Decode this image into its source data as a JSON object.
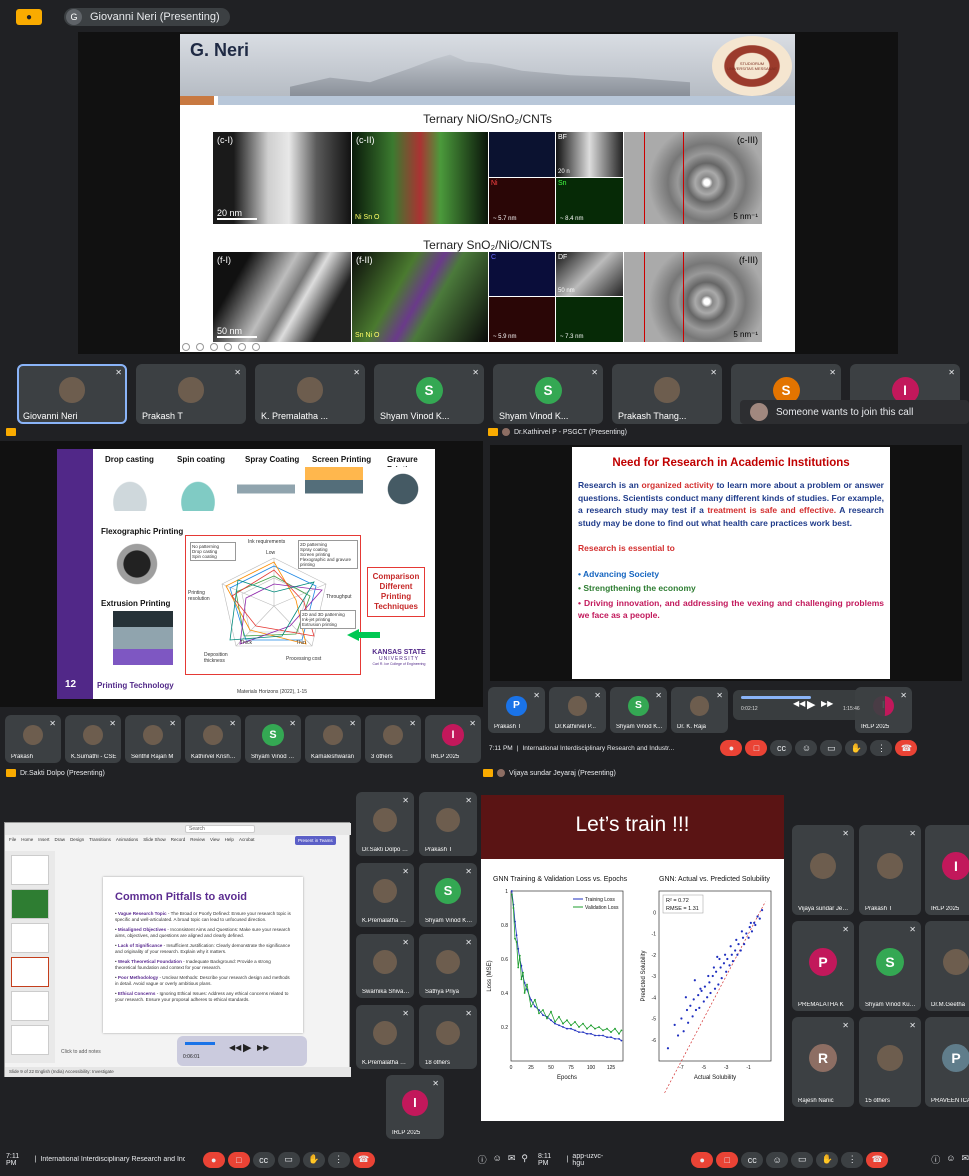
{
  "p1": {
    "presenter_name": "Giovanni Neri (Presenting)",
    "avatar_letter": "G",
    "slide": {
      "title": "G. Neri",
      "seal_text": "STUDIORUM UNIVERSITAS MESSANAE",
      "caption1": "Ternary NiO/SnO₂/CNTs",
      "caption2": "Ternary SnO₂/NiO/CNTs",
      "panels_top": [
        "(c-I)",
        "(c-II)",
        "BF",
        "(c-III)"
      ],
      "panels_bottom": [
        "(f-I)",
        "(f-II)",
        "C",
        "DF",
        "(f-III)"
      ],
      "scale_top": "20 nm",
      "scale_bottom": "50 nm",
      "scale_5nm": "5 nm⁻¹",
      "edx_top": "Ni Sn O",
      "edx_bottom": "Sn Ni O",
      "ni_label": "Ni",
      "sn_label": "Sn",
      "bf_scale": "20 n",
      "df_scale": "50 nm",
      "meas": [
        "~ 5.7 nm",
        "~ 8.4 nm",
        "~ 5.9 nm",
        "~ 7.3 nm"
      ]
    },
    "participants": [
      {
        "name": "Giovanni Neri",
        "letter": "",
        "color": "#5f6368",
        "selected": true
      },
      {
        "name": "Prakash T",
        "letter": "",
        "color": "",
        "selected": false
      },
      {
        "name": "K. Premalatha ...",
        "letter": "",
        "color": "",
        "selected": false
      },
      {
        "name": "Shyam Vinod K...",
        "letter": "S",
        "color": "#34a853",
        "selected": false
      },
      {
        "name": "Shyam Vinod K...",
        "letter": "S",
        "color": "#34a853",
        "selected": false
      },
      {
        "name": "Prakash Thang...",
        "letter": "",
        "color": "",
        "selected": false
      },
      {
        "name": "",
        "letter": "S",
        "color": "#e37400",
        "selected": false
      },
      {
        "name": "",
        "letter": "I",
        "color": "#c2185b",
        "selected": false
      }
    ],
    "join_notice": "Someone wants to join this call"
  },
  "p2": {
    "slide": {
      "techniques": [
        "Drop casting",
        "Spin coating",
        "Spray Coating",
        "Screen Printing",
        "Gravure Printing",
        "Flexographic Printing",
        "Extrusion Printing"
      ],
      "legend_no": [
        "No patterning",
        "Drop casting",
        "Spin coating"
      ],
      "legend_2d": [
        "2D patterning",
        "Spray coating",
        "Screen printing",
        "Flexographic and gravure printing"
      ],
      "legend_3d": [
        "2D and 3D patterning",
        "Ink-jet printing",
        "Extrusion printing"
      ],
      "radar_labels": [
        "Ink requirements",
        "Low",
        "High",
        "Throughput",
        "Printing resolution",
        "High",
        "Low",
        "Deposition thickness",
        "Thick",
        "Thin",
        "Processing cost"
      ],
      "compare": "Comparison Different Printing Techniques",
      "footer_num": "12",
      "footer_text": "Printing Technology",
      "kstate": "KANSAS STATE",
      "kstate2": "UNIVERSITY",
      "kstate3": "Carl R. Ice College of Engineering",
      "cite": "Materials Horizons (2022), 1-15"
    },
    "participants": [
      {
        "name": "Prakash",
        "letter": "",
        "color": ""
      },
      {
        "name": "K.Sumathi - CSE",
        "letter": "",
        "color": ""
      },
      {
        "name": "Senthil Rajan M",
        "letter": "",
        "color": ""
      },
      {
        "name": "Kathirvel Krishna...",
        "letter": "",
        "color": ""
      },
      {
        "name": "Shyam Vinod K...",
        "letter": "S",
        "color": "#34a853"
      },
      {
        "name": "Kamaleshwaran",
        "letter": "",
        "color": ""
      },
      {
        "name": "3 others",
        "letter": "",
        "color": ""
      },
      {
        "name": "IRLP 2025",
        "letter": "I",
        "color": "#c2185b"
      }
    ]
  },
  "p3": {
    "presenter_name": "Dr.Kathirvel P - PSGCT (Presenting)",
    "slide": {
      "title": "Need for Research in Academic Institutions",
      "p1_a": "Research is an ",
      "p1_b": "organized activity",
      "p1_c": " to learn more about a problem or answer questions. Scientists conduct many different kinds of studies. For example, a research study may test if a ",
      "p1_d": "treatment is safe and effective.",
      "p1_e": " A research study may be done to find out what health care practices work best.",
      "essential": "Research is essential to",
      "b1": "• Advancing Society",
      "b2": "• Strengthening the economy",
      "b3": "• Driving innovation, and addressing the vexing and challenging problems we face as a people."
    },
    "participants": [
      {
        "name": "Prakash T",
        "letter": "P",
        "color": "#1a73e8"
      },
      {
        "name": "Dr.Kathirvel P...",
        "letter": "",
        "color": ""
      },
      {
        "name": "Shyam Vinod K...",
        "letter": "S",
        "color": "#34a853"
      },
      {
        "name": "Dr. K. Raja",
        "letter": "",
        "color": ""
      },
      {
        "name": "IRLP 2025",
        "letter": "I",
        "color": "#c2185b"
      }
    ],
    "media_time_a": "0:02:12",
    "media_time_b": "1:15:46",
    "bottom_time": "7:11 PM",
    "bottom_title": "International Interdisciplinary Research and Industr..."
  },
  "p4": {
    "presenter_name": "Dr.Sakti Dolpo (Presenting)",
    "ppt_menu": [
      "File",
      "Home",
      "Insert",
      "Draw",
      "Design",
      "Transitions",
      "Animations",
      "Slide Show",
      "Record",
      "Review",
      "View",
      "Help",
      "Acrobat"
    ],
    "present_btn": "Present in Teams",
    "search": "Search",
    "slide_title": "Common Pitfalls to avoid",
    "bullets": [
      {
        "head": "Vague Research Topic",
        "rest": " - The Broad or Poorly Defined: Ensure your research topic is specific and well-articulated. A broad topic can lead to unfocused direction."
      },
      {
        "head": "Misaligned Objectives",
        "rest": " - Inconsistent Aims and Questions: Make sure your research aims, objectives, and questions are aligned and clearly defined."
      },
      {
        "head": "Lack of Significance",
        "rest": " - Insufficient Justification: Clearly demonstrate the significance and originality of your research. Explain why it matters."
      },
      {
        "head": "Weak Theoretical Foundation",
        "rest": " - Inadequate Background: Provide a strong theoretical foundation and context for your research."
      },
      {
        "head": "Poor Methodology",
        "rest": " - Unclear Methods: Describe your research design and methods in detail. Avoid vague or overly ambitious plans."
      },
      {
        "head": "Ethical Concerns",
        "rest": " - Ignoring Ethical Issues: Address any ethical concerns related to your research. Ensure your proposal adheres to ethical standards."
      }
    ],
    "notes_hint": "Click to add notes",
    "status": "Slide 9 of 22  English (India)  Accessibility: Investigate",
    "media_time": "0:06:01",
    "participants": [
      {
        "name": "Dr.Sakti Dolpo (Prese...",
        "letter": "",
        "color": ""
      },
      {
        "name": "Prakash T",
        "letter": "",
        "color": ""
      },
      {
        "name": "K.Premalatha Durgapal...",
        "letter": "",
        "color": ""
      },
      {
        "name": "Shyam Vinod Kumar P",
        "letter": "S",
        "color": "#34a853"
      },
      {
        "name": "Swarnika Shivakumar",
        "letter": "",
        "color": ""
      },
      {
        "name": "Sathya Priya",
        "letter": "",
        "color": ""
      },
      {
        "name": "K.Premalatha Durgapal...",
        "letter": "",
        "color": ""
      },
      {
        "name": "18 others",
        "letter": "",
        "color": ""
      },
      {
        "name": "IRLP 2025",
        "letter": "I",
        "color": "#c2185b"
      }
    ]
  },
  "p5": {
    "presenter_name": "Vijaya sundar Jeyaraj (Presenting)",
    "slide_title": "Let’s train !!!",
    "chart1_title": "GNN Training & Validation Loss vs. Epochs",
    "chart2_title": "GNN: Actual vs. Predicted Solubility",
    "r2_text": "R² = 0.72",
    "rmse_text": "RMSE = 1.31",
    "participants": [
      {
        "name": "Vijaya sundar Jeyaraj",
        "letter": "",
        "color": ""
      },
      {
        "name": "Prakash T",
        "letter": "",
        "color": ""
      },
      {
        "name": "IRLP 2025",
        "letter": "I",
        "color": "#c2185b"
      },
      {
        "name": "PREMALATHA K",
        "letter": "P",
        "color": "#c2185b"
      },
      {
        "name": "Shyam Vinod Kumar P",
        "letter": "S",
        "color": "#34a853"
      },
      {
        "name": "Dr.M.Geetha",
        "letter": "",
        "color": ""
      },
      {
        "name": "Rajesh Nanic",
        "letter": "R",
        "color": "#8d6e63"
      },
      {
        "name": "15 others",
        "letter": "",
        "color": ""
      },
      {
        "name": "PRAVEEN ICA208",
        "letter": "P",
        "color": "#607d8b"
      }
    ]
  },
  "taskbar": {
    "left_time": "7:11 PM",
    "left_title": "International Interdisciplinary Research and Industr...",
    "mid_time": "8:11 PM",
    "mid_code": "app-uzvc-hgu"
  },
  "chart_data": [
    {
      "type": "line",
      "title": "GNN Training & Validation Loss vs. Epochs",
      "xlabel": "Epochs",
      "ylabel": "Loss (MSE)",
      "xlim": [
        0,
        140
      ],
      "ylim": [
        0,
        1.0
      ],
      "x_ticks": [
        0,
        25,
        50,
        75,
        100,
        125
      ],
      "y_ticks": [
        0.2,
        0.4,
        0.6,
        0.8,
        1.0
      ],
      "legend": "top-right",
      "series": [
        {
          "name": "Training Loss",
          "color": "#1f2fbf",
          "x": [
            1,
            3,
            5,
            7,
            9,
            11,
            13,
            15,
            17,
            20,
            25,
            30,
            35,
            40,
            45,
            50,
            55,
            60,
            65,
            70,
            75,
            80,
            85,
            90,
            95,
            100,
            105,
            110,
            115,
            120,
            125,
            130,
            135,
            138
          ],
          "values": [
            1.0,
            0.92,
            0.82,
            0.74,
            0.66,
            0.6,
            0.56,
            0.5,
            0.46,
            0.42,
            0.36,
            0.32,
            0.3,
            0.27,
            0.26,
            0.24,
            0.22,
            0.21,
            0.2,
            0.19,
            0.19,
            0.18,
            0.17,
            0.17,
            0.16,
            0.16,
            0.15,
            0.15,
            0.15,
            0.14,
            0.14,
            0.13,
            0.13,
            0.12
          ]
        },
        {
          "name": "Validation Loss",
          "color": "#1e9e2e",
          "x": [
            1,
            3,
            5,
            7,
            9,
            11,
            13,
            15,
            17,
            20,
            25,
            30,
            35,
            40,
            45,
            50,
            55,
            60,
            65,
            70,
            75,
            80,
            85,
            90,
            95,
            100,
            105,
            110,
            115,
            120,
            125,
            130,
            135,
            138
          ],
          "values": [
            0.98,
            0.9,
            0.72,
            0.7,
            0.55,
            0.62,
            0.48,
            0.52,
            0.4,
            0.45,
            0.32,
            0.36,
            0.28,
            0.3,
            0.25,
            0.29,
            0.23,
            0.26,
            0.22,
            0.24,
            0.21,
            0.23,
            0.2,
            0.22,
            0.19,
            0.21,
            0.19,
            0.2,
            0.18,
            0.19,
            0.17,
            0.19,
            0.16,
            0.18
          ]
        }
      ]
    },
    {
      "type": "scatter",
      "title": "GNN: Actual vs. Predicted Solubility",
      "xlabel": "Actual Solubility",
      "ylabel": "Predicted Solubility",
      "xlim": [
        -9,
        1
      ],
      "ylim": [
        -7,
        1
      ],
      "x_ticks": [
        -8,
        -7,
        -6,
        -5,
        -4,
        -3,
        -2,
        -1,
        0
      ],
      "y_ticks": [
        -6,
        -5,
        -4,
        -3,
        -2,
        -1,
        0
      ],
      "annotations": [
        "R² = 0.72",
        "RMSE = 1.31"
      ],
      "series": [
        {
          "name": "",
          "color": "#1f2fbf",
          "x": [
            -8.2,
            -7.6,
            -7.3,
            -7.0,
            -6.8,
            -6.5,
            -6.4,
            -6.2,
            -6.0,
            -5.9,
            -5.7,
            -5.5,
            -5.4,
            -5.2,
            -5.0,
            -4.9,
            -4.7,
            -4.5,
            -4.4,
            -4.2,
            -4.0,
            -3.9,
            -3.7,
            -3.5,
            -3.4,
            -3.2,
            -3.0,
            -2.9,
            -2.7,
            -2.5,
            -2.4,
            -2.2,
            -2.0,
            -1.9,
            -1.7,
            -1.5,
            -1.4,
            -1.2,
            -1.0,
            -0.9,
            -0.7,
            -0.5,
            -0.4,
            -0.2,
            0.0,
            0.2,
            -3.8,
            -4.6,
            -5.8,
            -2.6,
            -1.6,
            -6.6,
            -3.1,
            -4.1,
            -2.1,
            -0.8,
            -5.3,
            -3.6
          ],
          "values": [
            -6.4,
            -5.3,
            -5.8,
            -5.0,
            -5.6,
            -4.6,
            -5.2,
            -4.4,
            -4.9,
            -4.1,
            -4.6,
            -3.9,
            -4.5,
            -3.7,
            -4.2,
            -3.5,
            -4.0,
            -3.3,
            -3.8,
            -3.0,
            -3.6,
            -2.8,
            -3.4,
            -2.6,
            -3.1,
            -2.4,
            -2.8,
            -2.2,
            -2.5,
            -2.0,
            -2.3,
            -1.8,
            -2.0,
            -1.5,
            -1.8,
            -1.2,
            -1.5,
            -1.0,
            -1.2,
            -0.7,
            -0.9,
            -0.5,
            -0.6,
            -0.2,
            -0.3,
            0.1,
            -2.1,
            -3.0,
            -3.2,
            -1.6,
            -0.9,
            -4.0,
            -2.0,
            -2.6,
            -1.3,
            -0.5,
            -3.6,
            -2.2
          ]
        },
        {
          "name": "",
          "color": "#d32f2f",
          "x": [
            -8.5,
            0.5
          ],
          "values": [
            -8.5,
            0.5
          ]
        }
      ]
    }
  ]
}
